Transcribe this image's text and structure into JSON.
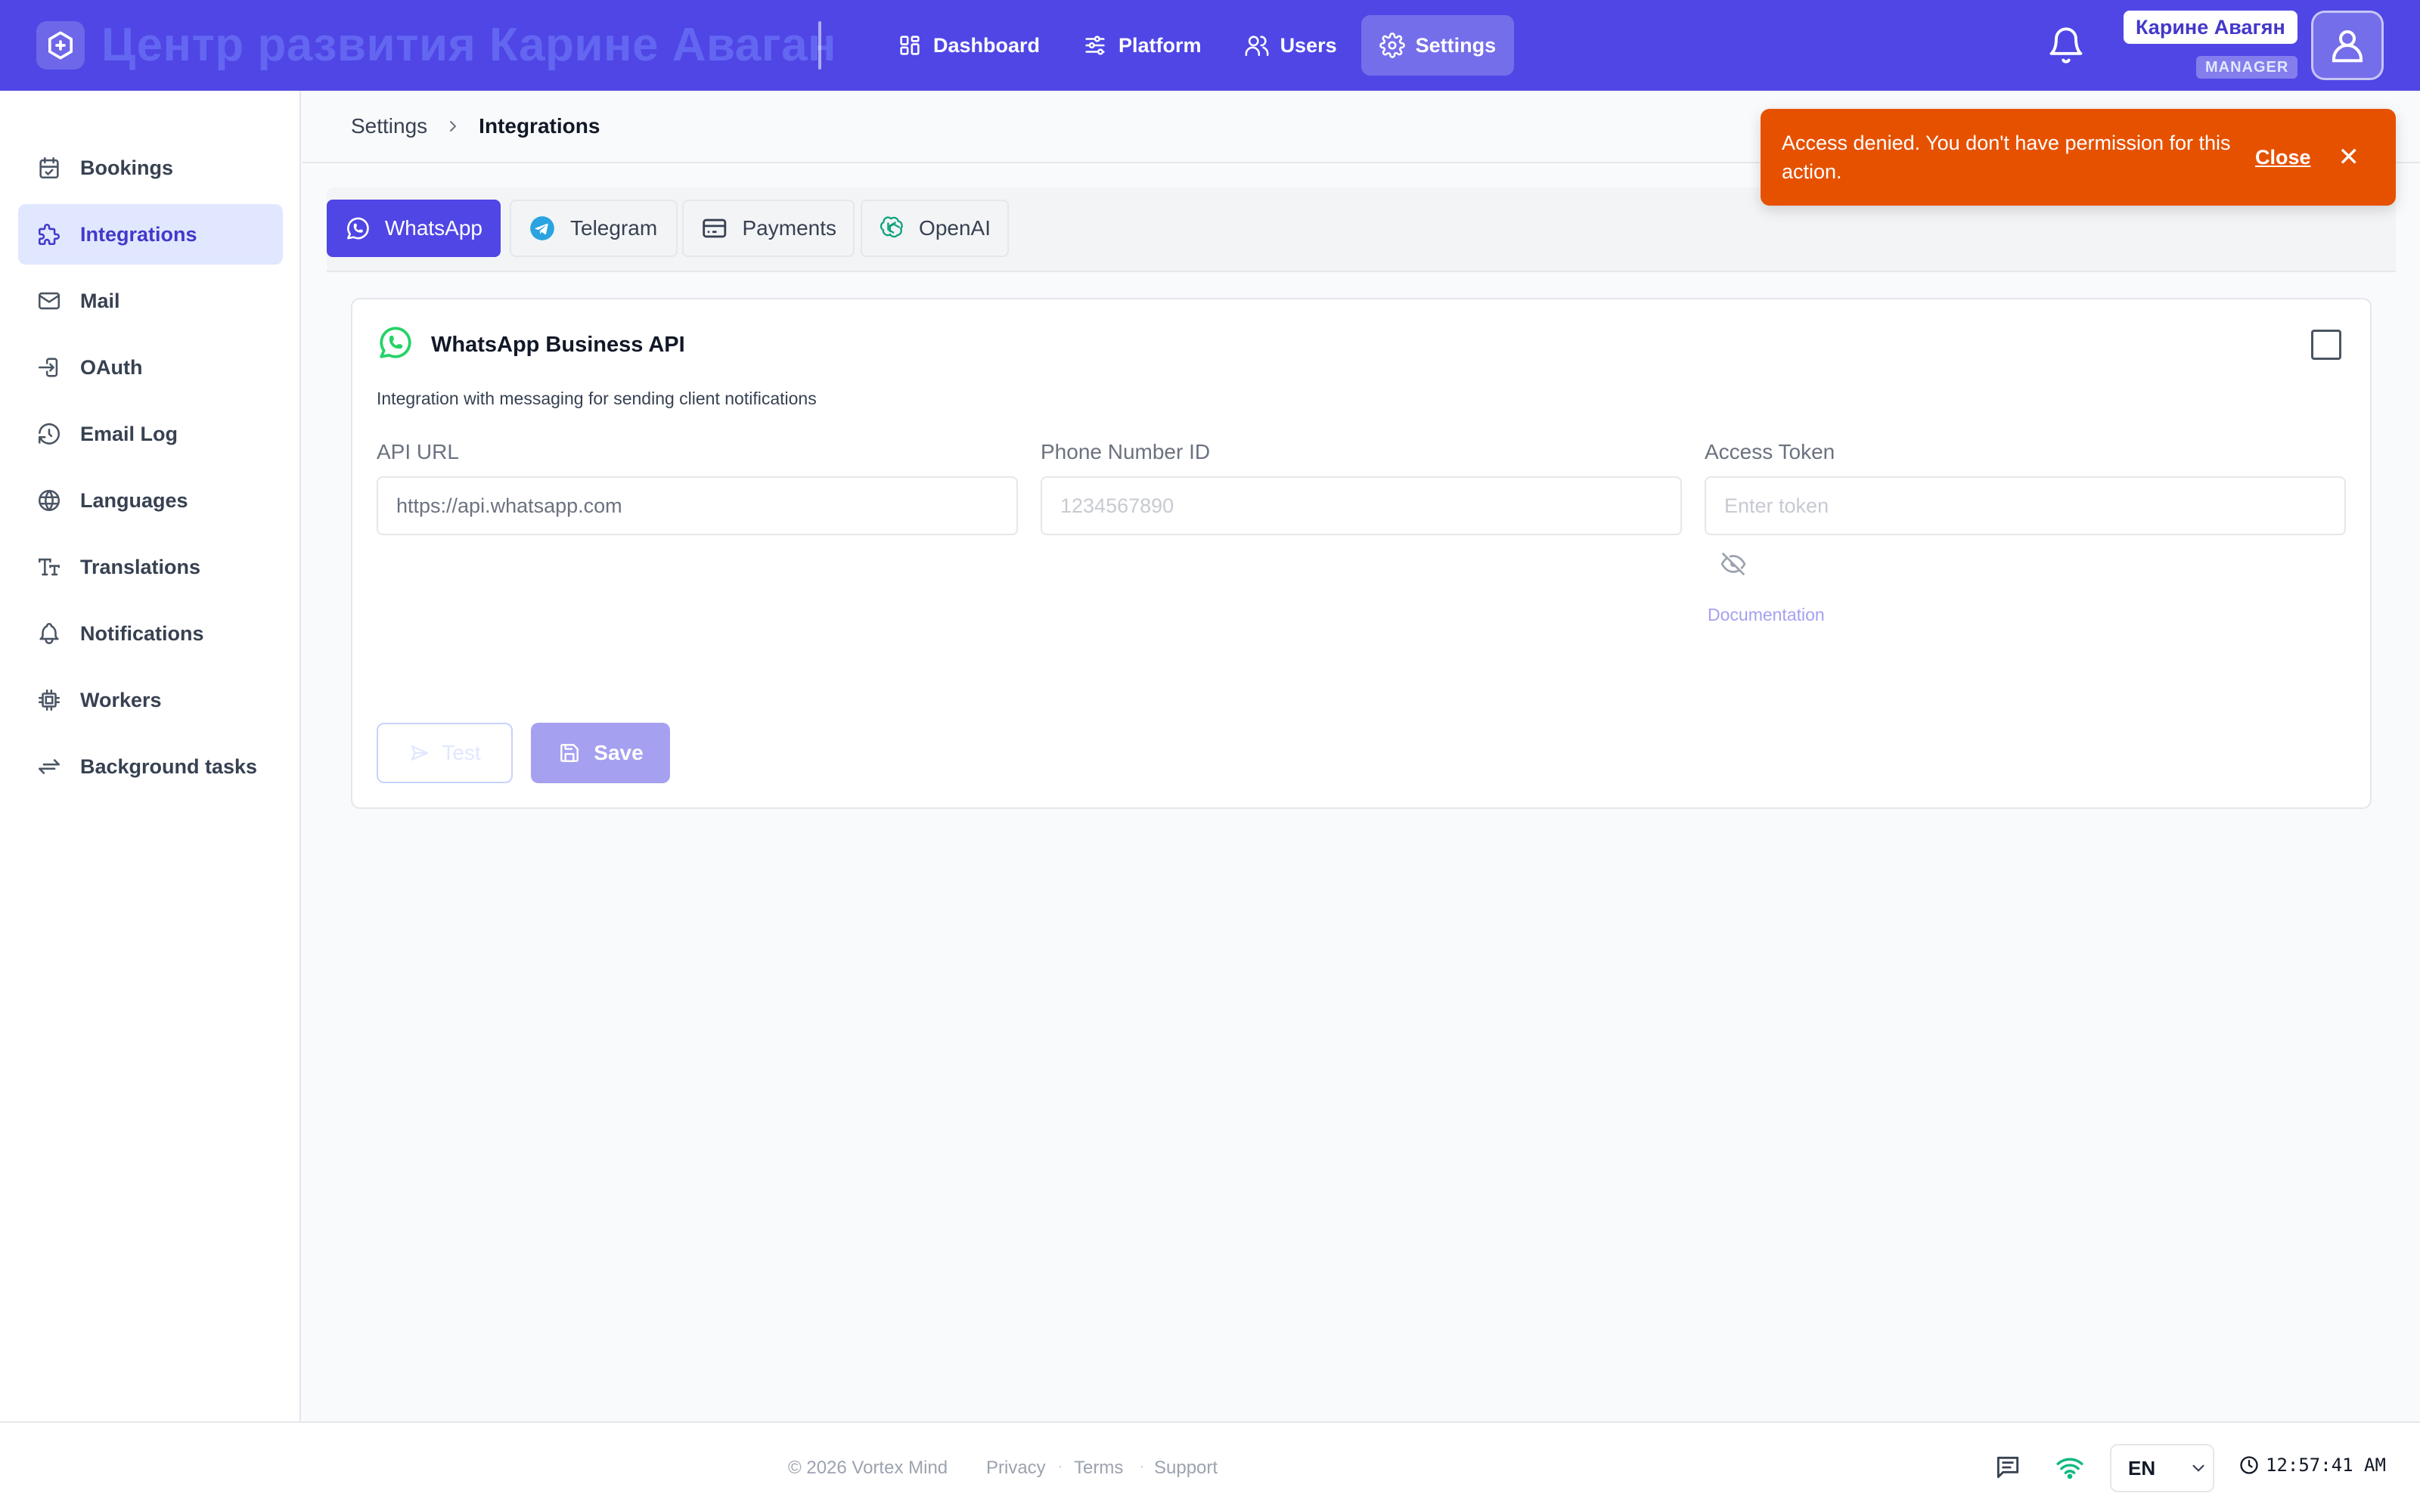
{
  "header": {
    "app_title": "Центр развития Карине Аваган",
    "nav": [
      {
        "label": "Dashboard",
        "icon": "dashboard-icon"
      },
      {
        "label": "Platform",
        "icon": "sliders-icon"
      },
      {
        "label": "Users",
        "icon": "users-icon"
      },
      {
        "label": "Settings",
        "icon": "gear-icon",
        "active": true
      }
    ],
    "user_name": "Карине Авагян",
    "user_role": "MANAGER"
  },
  "sidebar": {
    "items": [
      {
        "label": "Bookings",
        "icon": "calendar-check-icon"
      },
      {
        "label": "Integrations",
        "icon": "puzzle-icon",
        "active": true
      },
      {
        "label": "Mail",
        "icon": "mail-icon"
      },
      {
        "label": "OAuth",
        "icon": "login-icon"
      },
      {
        "label": "Email Log",
        "icon": "history-icon"
      },
      {
        "label": "Languages",
        "icon": "globe-icon"
      },
      {
        "label": "Translations",
        "icon": "text-size-icon"
      },
      {
        "label": "Notifications",
        "icon": "bell-icon"
      },
      {
        "label": "Workers",
        "icon": "cpu-icon"
      },
      {
        "label": "Background tasks",
        "icon": "arrows-exchange-icon"
      }
    ]
  },
  "breadcrumb": {
    "parent": "Settings",
    "current": "Integrations"
  },
  "toast": {
    "message": "Access denied. You don't have permission for this action.",
    "close_label": "Close",
    "color": "#e65100"
  },
  "tabs": [
    {
      "label": "WhatsApp",
      "icon": "whatsapp-icon",
      "active": true
    },
    {
      "label": "Telegram",
      "icon": "telegram-icon"
    },
    {
      "label": "Payments",
      "icon": "credit-card-icon"
    },
    {
      "label": "OpenAI",
      "icon": "openai-icon"
    }
  ],
  "integration": {
    "title": "WhatsApp Business API",
    "description": "Integration with messaging for sending client notifications",
    "enabled": false,
    "fields": {
      "api_url": {
        "label": "API URL",
        "value": "https://api.whatsapp.com",
        "placeholder": ""
      },
      "phone_number_id": {
        "label": "Phone Number ID",
        "value": "",
        "placeholder": "1234567890"
      },
      "access_token": {
        "label": "Access Token",
        "value": "",
        "placeholder": "Enter token"
      }
    },
    "documentation_label": "Documentation",
    "test_label": "Test",
    "save_label": "Save"
  },
  "footer": {
    "copyright": "© 2026 Vortex Mind",
    "links": [
      "Privacy",
      "Terms",
      "Support"
    ],
    "separator": "·",
    "language": "EN",
    "time": "12:57:41 AM"
  },
  "colors": {
    "primary": "#4f46e5",
    "primary_light": "#e0e7ff",
    "whatsapp": "#25d366",
    "telegram": "#2aa3e0",
    "openai": "#10a37f"
  }
}
